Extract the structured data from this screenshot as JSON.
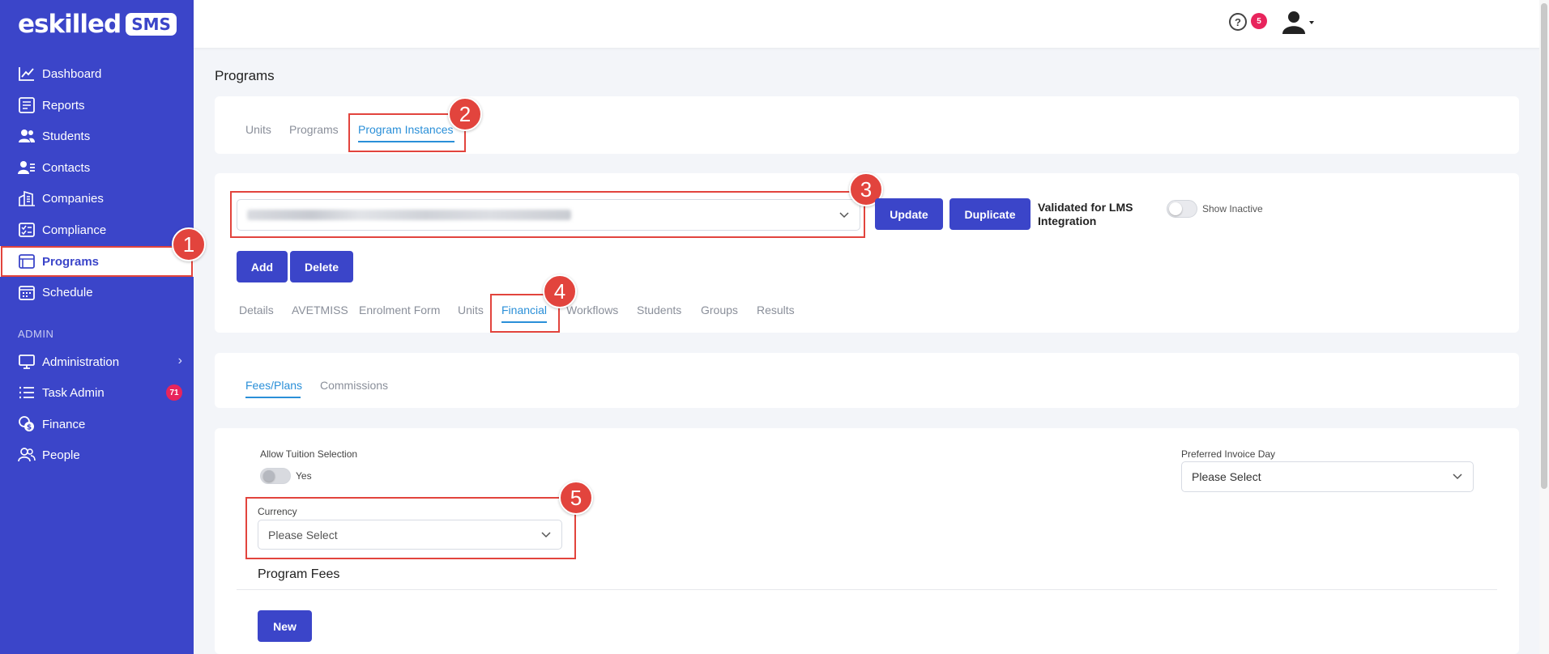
{
  "brand": {
    "name": "eskilled",
    "badge": "SMS"
  },
  "sidebar": {
    "collapse_glyph": "«",
    "items": [
      {
        "label": "Dashboard",
        "icon": "chart-line-icon"
      },
      {
        "label": "Reports",
        "icon": "report-icon"
      },
      {
        "label": "Students",
        "icon": "students-icon"
      },
      {
        "label": "Contacts",
        "icon": "contacts-icon"
      },
      {
        "label": "Companies",
        "icon": "companies-icon"
      },
      {
        "label": "Compliance",
        "icon": "compliance-icon"
      },
      {
        "label": "Programs",
        "icon": "programs-icon",
        "active": true
      },
      {
        "label": "Schedule",
        "icon": "calendar-icon"
      }
    ],
    "section_label": "ADMIN",
    "admin_items": [
      {
        "label": "Administration",
        "icon": "monitor-icon"
      },
      {
        "label": "Task Admin",
        "icon": "list-icon",
        "badge": "71"
      },
      {
        "label": "Finance",
        "icon": "finance-icon"
      },
      {
        "label": "People",
        "icon": "people-icon"
      }
    ]
  },
  "topbar": {
    "help_glyph": "?",
    "notification_count": "5"
  },
  "page": {
    "title": "Programs"
  },
  "program_tabs": [
    "Units",
    "Programs",
    "Program Instances"
  ],
  "toolbar": {
    "update_label": "Update",
    "duplicate_label": "Duplicate",
    "lms_line1": "Validated for LMS",
    "lms_line2": "Integration",
    "show_inactive_label": "Show Inactive",
    "add_label": "Add",
    "delete_label": "Delete"
  },
  "instance_tabs": [
    "Details",
    "AVETMISS",
    "Enrolment Form",
    "Units",
    "Financial",
    "Workflows",
    "Students",
    "Groups",
    "Results"
  ],
  "financial_tabs": [
    "Fees/Plans",
    "Commissions"
  ],
  "form": {
    "allow_tuition_label": "Allow Tuition Selection",
    "allow_tuition_value": "Yes",
    "currency_label": "Currency",
    "currency_placeholder": "Please Select",
    "invoice_day_label": "Preferred Invoice Day",
    "invoice_day_value": "Please Select",
    "program_fees_heading": "Program Fees",
    "new_label": "New"
  },
  "callouts": [
    "1",
    "2",
    "3",
    "4",
    "5"
  ],
  "colors": {
    "primary": "#3b45c9",
    "accent_tab": "#2a8fd8",
    "callout": "#e2443d",
    "badge": "#e8245c"
  }
}
